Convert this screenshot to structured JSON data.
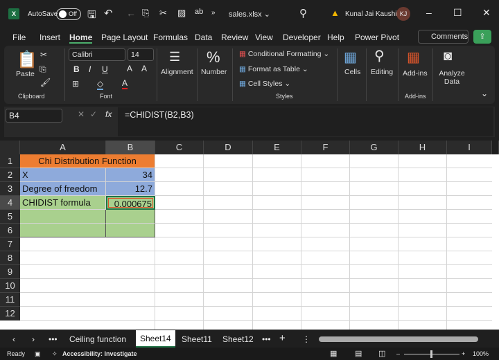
{
  "titlebar": {
    "autosave": "AutoSave",
    "toggle": "Off",
    "filename": "sales.xlsx ⌄",
    "user": "Kunal Jai Kaushik",
    "initials": "KJ"
  },
  "menu": [
    "File",
    "Insert",
    "Home",
    "Page Layout",
    "Formulas",
    "Data",
    "Review",
    "View",
    "Developer",
    "Help",
    "Power Pivot"
  ],
  "comments": "Comments",
  "ribbon": {
    "paste": "Paste",
    "clipboard": "Clipboard",
    "font_name": "Calibri",
    "font_size": "14",
    "font": "Font",
    "alignment": "Alignment",
    "number": "Number",
    "conditional": "Conditional Formatting",
    "format_table": "Format as Table",
    "cell_styles": "Cell Styles",
    "styles": "Styles",
    "cells": "Cells",
    "editing": "Editing",
    "addins": "Add-ins",
    "addins_group": "Add-ins",
    "analyze": "Analyze Data"
  },
  "formula_bar": {
    "name_box": "B4",
    "fx": "fx",
    "formula": "=CHIDIST(B2,B3)"
  },
  "columns": [
    "A",
    "B",
    "C",
    "D",
    "E",
    "F",
    "G",
    "H",
    "I"
  ],
  "rows": [
    "1",
    "2",
    "3",
    "4",
    "5",
    "6",
    "7",
    "8",
    "9",
    "10",
    "11",
    "12"
  ],
  "cells": {
    "a1": "Chi Distribution Function",
    "a2": "X",
    "b2": "34",
    "a3": "Degree of freedom",
    "b3": "12.7",
    "a4": "CHIDIST formula",
    "b4": "0.000675"
  },
  "colors": {
    "orange": "#ed7d31",
    "blue": "#8eaadb",
    "green": "#a9d08e",
    "accent": "#217346"
  },
  "sheets": [
    "Ceiling function",
    "Sheet14",
    "Sheet11",
    "Sheet12"
  ],
  "active_sheet": "Sheet14",
  "status": {
    "ready": "Ready",
    "accessibility": "Accessibility: Investigate",
    "zoom": "100%"
  }
}
